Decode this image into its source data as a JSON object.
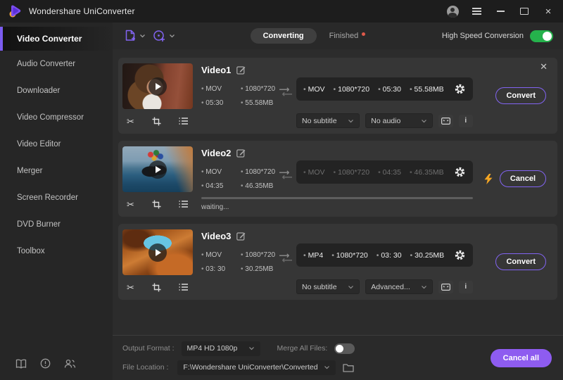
{
  "titlebar": {
    "title": "Wondershare UniConverter"
  },
  "sidebar": {
    "items": [
      {
        "label": "Video Converter",
        "active": true
      },
      {
        "label": "Audio Converter",
        "active": false
      },
      {
        "label": "Downloader",
        "active": false
      },
      {
        "label": "Video Compressor",
        "active": false
      },
      {
        "label": "Video Editor",
        "active": false
      },
      {
        "label": "Merger",
        "active": false
      },
      {
        "label": "Screen Recorder",
        "active": false
      },
      {
        "label": "DVD Burner",
        "active": false
      },
      {
        "label": "Toolbox",
        "active": false
      }
    ]
  },
  "toolbar": {
    "tabs": [
      {
        "label": "Converting",
        "active": true
      },
      {
        "label": "Finished",
        "active": false,
        "dot": true
      }
    ],
    "high_speed_label": "High Speed Conversion",
    "high_speed_on": true
  },
  "rows": [
    {
      "title": "Video1",
      "thumb_class": "thumb-girl",
      "meta": {
        "format": "MOV",
        "resolution": "1080*720",
        "duration": "05:30",
        "size": "55.58MB"
      },
      "output": {
        "format": "MOV",
        "resolution": "1080*720",
        "duration": "05:30",
        "size": "55.58MB"
      },
      "output_dimmed": false,
      "action": "Convert",
      "show_close": true,
      "show_bolt": false,
      "show_dropdowns": true,
      "subtitle": "No subtitle",
      "audio": "No audio",
      "show_progress": false,
      "status": ""
    },
    {
      "title": "Video2",
      "thumb_class": "thumb-balloons",
      "meta": {
        "format": "MOV",
        "resolution": "1080*720",
        "duration": "04:35",
        "size": "46.35MB"
      },
      "output": {
        "format": "MOV",
        "resolution": "1080*720",
        "duration": "04:35",
        "size": "46.35MB"
      },
      "output_dimmed": true,
      "action": "Cancel",
      "show_close": false,
      "show_bolt": true,
      "show_dropdowns": false,
      "subtitle": "",
      "audio": "",
      "show_progress": true,
      "status": "waiting..."
    },
    {
      "title": "Video3",
      "thumb_class": "thumb-canyon",
      "meta": {
        "format": "MOV",
        "resolution": "1080*720",
        "duration": "03: 30",
        "size": "30.25MB"
      },
      "output": {
        "format": "MP4",
        "resolution": "1080*720",
        "duration": "03: 30",
        "size": "30.25MB"
      },
      "output_dimmed": false,
      "action": "Convert",
      "show_close": false,
      "show_bolt": false,
      "show_dropdowns": true,
      "subtitle": "No subtitle",
      "audio": "Advanced...",
      "show_progress": false,
      "status": ""
    }
  ],
  "footer": {
    "output_format_label": "Output Format :",
    "output_format_value": "MP4 HD 1080p",
    "merge_label": "Merge All Files:",
    "merge_on": false,
    "file_location_label": "File Location :",
    "file_location_value": "F:\\Wondershare UniConverter\\Converted",
    "cancel_all_label": "Cancel all"
  },
  "icons": {
    "info_button": "i"
  },
  "colors": {
    "accent_purple": "#8264f2",
    "toggle_green": "#25b24c",
    "finished_dot_red": "#e0594a",
    "bolt_orange": "#f5a623"
  }
}
